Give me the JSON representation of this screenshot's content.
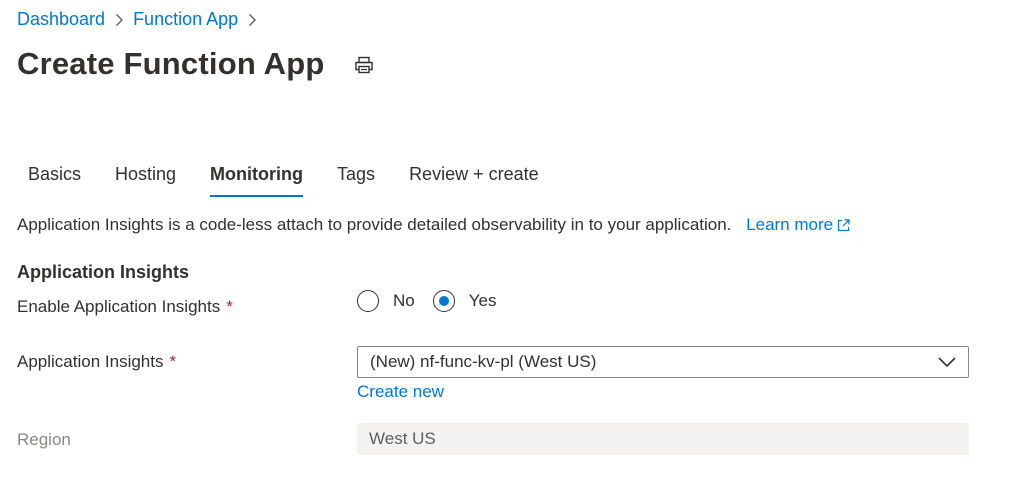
{
  "breadcrumb": {
    "items": [
      {
        "label": "Dashboard"
      },
      {
        "label": "Function App"
      }
    ]
  },
  "header": {
    "title": "Create Function App",
    "print_icon": "print-icon"
  },
  "tabs": [
    {
      "label": "Basics",
      "active": false
    },
    {
      "label": "Hosting",
      "active": false
    },
    {
      "label": "Monitoring",
      "active": true
    },
    {
      "label": "Tags",
      "active": false
    },
    {
      "label": "Review + create",
      "active": false
    }
  ],
  "description": {
    "text": "Application Insights is a code-less attach to provide detailed observability in to your application.",
    "link_label": "Learn more",
    "link_icon": "external-link-icon"
  },
  "section": {
    "title": "Application Insights"
  },
  "form": {
    "enable_label": "Enable Application Insights",
    "required_marker": "*",
    "enable_options": [
      {
        "label": "No",
        "selected": false
      },
      {
        "label": "Yes",
        "selected": true
      }
    ],
    "insights_label": "Application Insights",
    "insights_value": "(New) nf-func-kv-pl (West US)",
    "create_new_label": "Create new",
    "region_label": "Region",
    "region_value": "West US"
  },
  "colors": {
    "accent": "#0078d4",
    "required": "#a4262c",
    "disabled_bg": "#f3f2f1"
  }
}
